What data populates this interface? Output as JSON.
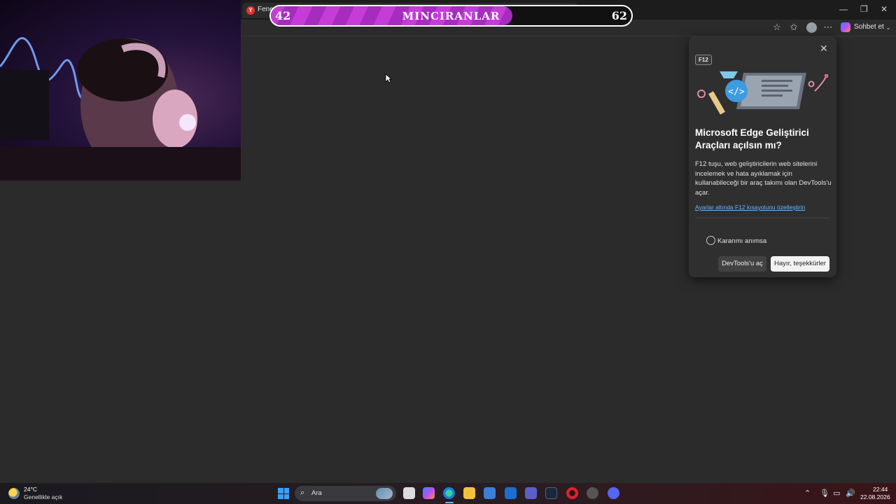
{
  "browser": {
    "tab_title": "Fenerl",
    "tab_favicon_text": "Y",
    "new_tab_label": "+",
    "toolbar_chat_label": "Sohbet et"
  },
  "overlay": {
    "score_left": "42",
    "score_right": "62",
    "team_name": "MINCIRANLAR",
    "progress": 0.67
  },
  "popup": {
    "badge": "F12",
    "title": "Microsoft Edge Geliştirici Araçları açılsın mı?",
    "description": "F12 tuşu, web geliştiricilerin web sitelerini incelemek ve hata ayıklamak için kullanabileceği bir araç takımı olan DevTools'u açar.",
    "link": "Ayarlar altında F12 kısayolunu özelleştirin",
    "remember_label": "Kararımı anımsa",
    "open_button": "DevTools'u aç",
    "decline_button": "Hayır, teşekkürler"
  },
  "taskbar": {
    "weather_temp": "24°C",
    "weather_desc": "Genellikle açık",
    "search_placeholder": "Ara",
    "time": "22:44",
    "date": "22.08.2026"
  },
  "colors": {
    "accent": "#6cb4ff",
    "overlay_fill": "#c53cd8",
    "background": "#2b2b2b"
  }
}
